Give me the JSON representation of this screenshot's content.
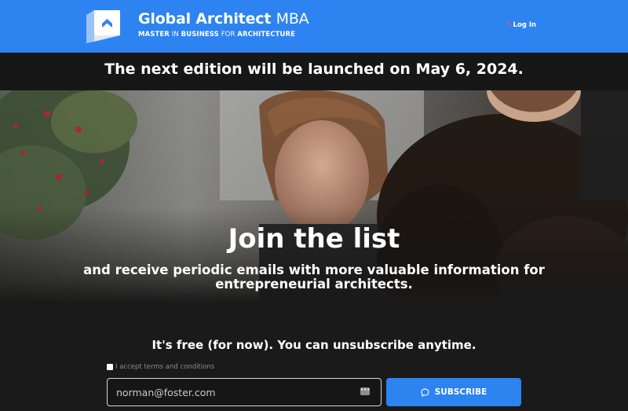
{
  "header": {
    "brand_strong": "Global Architect",
    "brand_light": "MBA",
    "tagline": {
      "part1": "MASTER",
      "part2": "IN",
      "part3": "BUSINESS",
      "part4": "FOR",
      "part5": "ARCHITECTURE"
    },
    "login_label": "Log In",
    "login_icon": "pin-icon",
    "logo_icon": "building-logo-icon",
    "accent_color": "#2d83f0"
  },
  "announcement": {
    "text": "The next edition will be launched on May 6, 2024."
  },
  "hero": {
    "title": "Join the list",
    "subtitle": "and receive periodic emails with more valuable information for entrepreneurial architects."
  },
  "signup": {
    "note": "It's free (for now). You can unsubscribe anytime.",
    "terms_prefix": "I accept",
    "terms_link": "terms and conditions",
    "terms_checked": false,
    "email_placeholder": "norman@foster.com",
    "autofill_icon": "autofill-key-icon",
    "subscribe_label": "SUBSCRIBE",
    "subscribe_icon": "chat-bubble-icon"
  }
}
